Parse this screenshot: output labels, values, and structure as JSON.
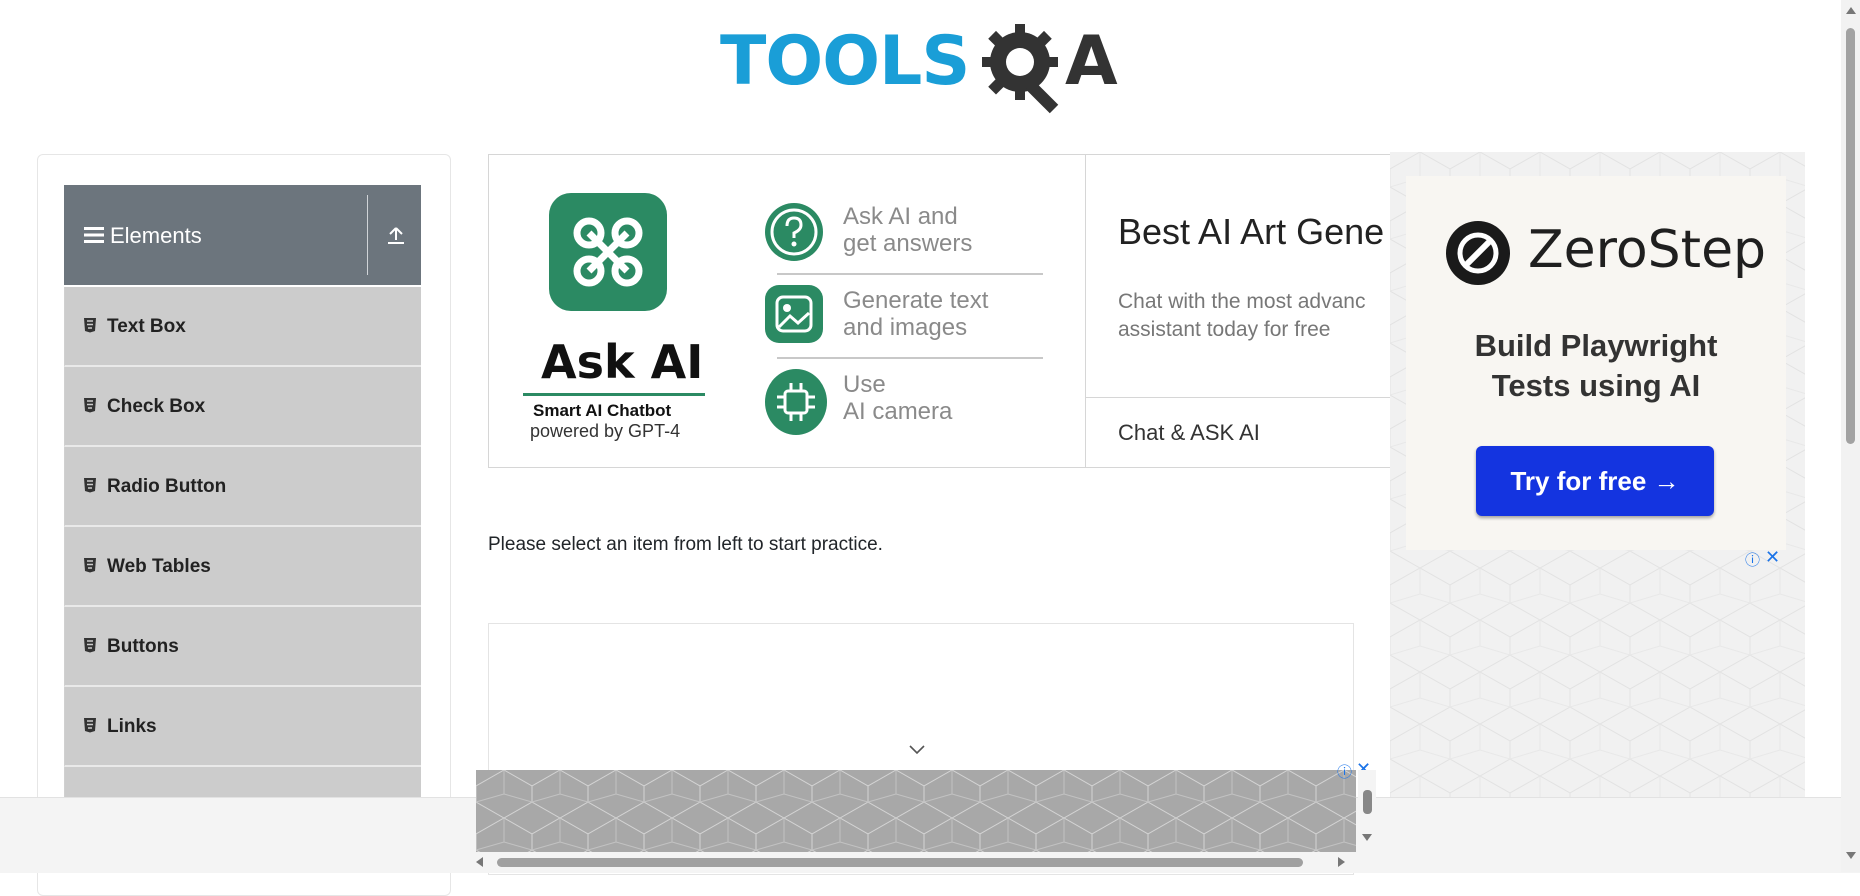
{
  "header": {
    "logo_text_left": "TOOLS",
    "logo_text_right": "A"
  },
  "sidebar": {
    "group_title": "Elements",
    "items": [
      {
        "label": "Text Box"
      },
      {
        "label": "Check Box"
      },
      {
        "label": "Radio Button"
      },
      {
        "label": "Web Tables"
      },
      {
        "label": "Buttons"
      },
      {
        "label": "Links"
      }
    ]
  },
  "ad_main": {
    "app_name": "Ask AI",
    "app_tagline": "Smart AI Chatbot",
    "app_powered": "powered by GPT-4",
    "features": [
      {
        "line1": "Ask AI and",
        "line2": "get answers",
        "icon": "question-icon"
      },
      {
        "line1": "Generate text",
        "line2": "and images",
        "icon": "image-icon"
      },
      {
        "line1": "Use",
        "line2": "AI camera",
        "icon": "chip-icon"
      }
    ],
    "headline": "Best AI Art Gene",
    "description_line1": "Chat with the most advanc",
    "description_line2": "assistant today for free",
    "cta": "Chat & ASK AI"
  },
  "ad_right": {
    "brand": "ZeroStep",
    "headline_line1": "Build Playwright",
    "headline_line2": "Tests using AI",
    "button": "Try for free →"
  },
  "main": {
    "practice_text": "Please select an item from left to start practice."
  },
  "colors": {
    "accent": "#1a9ed7",
    "sidebar_header": "#6c757d",
    "menu_bg": "#cccccc",
    "ai_green": "#2b8a63",
    "cta_blue": "#1434e0"
  }
}
